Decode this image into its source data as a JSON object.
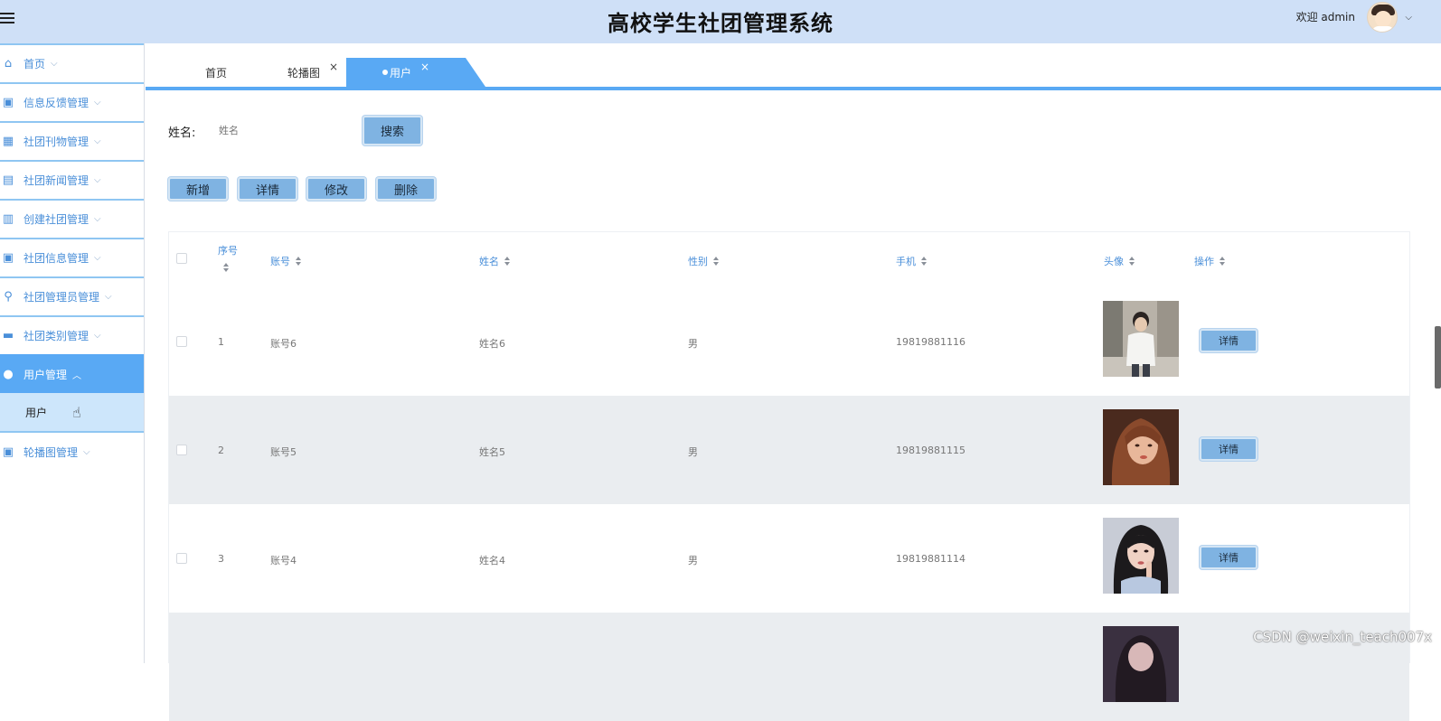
{
  "header": {
    "title": "高校学生社团管理系统",
    "welcome": "欢迎 admin",
    "menu_icon": "hamburger-icon",
    "avatar_icon": "user-avatar-icon",
    "caret_icon": "chevron-down-icon",
    "background": "#cfe0f7"
  },
  "sidebar": {
    "accent": "#59a9f4",
    "items": [
      {
        "label": "首页",
        "icon": "home-icon"
      },
      {
        "label": "信息反馈管理",
        "icon": "image-icon"
      },
      {
        "label": "社团刊物管理",
        "icon": "grid-icon"
      },
      {
        "label": "社团新闻管理",
        "icon": "layout-icon"
      },
      {
        "label": "创建社团管理",
        "icon": "gift-icon"
      },
      {
        "label": "社团信息管理",
        "icon": "image-icon"
      },
      {
        "label": "社团管理员管理",
        "icon": "person-icon"
      },
      {
        "label": "社团类别管理",
        "icon": "shop-icon"
      },
      {
        "label": "用户管理",
        "icon": "user-icon"
      },
      {
        "label": "轮播图管理",
        "icon": "image-icon"
      }
    ],
    "sub_item": {
      "label": "用户"
    }
  },
  "tabs": [
    {
      "label": "首页"
    },
    {
      "label": "轮播图",
      "close": "×"
    },
    {
      "label": "用户",
      "close": "×",
      "active": true
    }
  ],
  "search": {
    "label": "姓名:",
    "placeholder": "姓名",
    "button": "搜索"
  },
  "actions": {
    "add": "新增",
    "detail": "详情",
    "edit": "修改",
    "delete": "删除"
  },
  "table": {
    "columns": [
      "序号",
      "账号",
      "姓名",
      "性别",
      "手机",
      "头像",
      "操作"
    ],
    "rows": [
      {
        "index": "1",
        "account": "账号6",
        "name": "姓名6",
        "gender": "男",
        "phone": "19819881116",
        "action": "详情"
      },
      {
        "index": "2",
        "account": "账号5",
        "name": "姓名5",
        "gender": "男",
        "phone": "19819881115",
        "action": "详情"
      },
      {
        "index": "3",
        "account": "账号4",
        "name": "姓名4",
        "gender": "男",
        "phone": "19819881114",
        "action": "详情"
      }
    ]
  },
  "watermark": "CSDN @weixin_teach007x"
}
